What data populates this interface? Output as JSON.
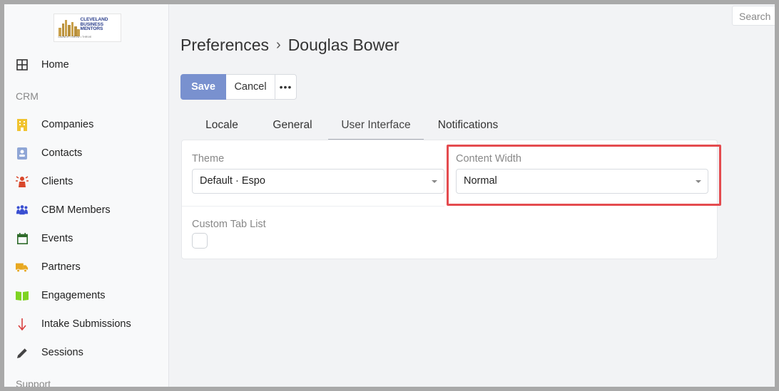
{
  "logo": {
    "line1": "CLEVELAND",
    "line2": "BUSINESS",
    "line3": "MENTORS",
    "tagline": "LAUNCH • GROW • THRIVE"
  },
  "search": {
    "placeholder": "Search"
  },
  "sidebar": {
    "sections": [
      {
        "label": "CRM"
      },
      {
        "label": "Support"
      }
    ],
    "items": [
      {
        "label": "Home",
        "icon": "grid-icon",
        "color": "#333333"
      },
      {
        "label": "Companies",
        "icon": "building-icon",
        "color": "#f0c330"
      },
      {
        "label": "Contacts",
        "icon": "contact-card-icon",
        "color": "#8fa6d6"
      },
      {
        "label": "Clients",
        "icon": "person-alert-icon",
        "color": "#d9472b"
      },
      {
        "label": "CBM Members",
        "icon": "group-icon",
        "color": "#3a4fd1"
      },
      {
        "label": "Events",
        "icon": "calendar-icon",
        "color": "#2f6b2a"
      },
      {
        "label": "Partners",
        "icon": "truck-icon",
        "color": "#e8a820"
      },
      {
        "label": "Engagements",
        "icon": "book-icon",
        "color": "#7ed321"
      },
      {
        "label": "Intake Submissions",
        "icon": "arrow-down-icon",
        "color": "#d94040"
      },
      {
        "label": "Sessions",
        "icon": "pencil-icon",
        "color": "#444444"
      }
    ]
  },
  "header": {
    "parent": "Preferences",
    "separator": "›",
    "title": "Douglas Bower"
  },
  "toolbar": {
    "save_label": "Save",
    "cancel_label": "Cancel",
    "more_label": "•••"
  },
  "tabs": [
    {
      "label": "Locale"
    },
    {
      "label": "General"
    },
    {
      "label": "User Interface",
      "active": true
    },
    {
      "label": "Notifications"
    }
  ],
  "form": {
    "theme": {
      "label": "Theme",
      "value": "Default · Espo"
    },
    "content_width": {
      "label": "Content Width",
      "value": "Normal"
    },
    "custom_tab_list": {
      "label": "Custom Tab List",
      "checked": false
    }
  },
  "colors": {
    "accent": "#7991cf",
    "highlight": "#e44b4f"
  }
}
